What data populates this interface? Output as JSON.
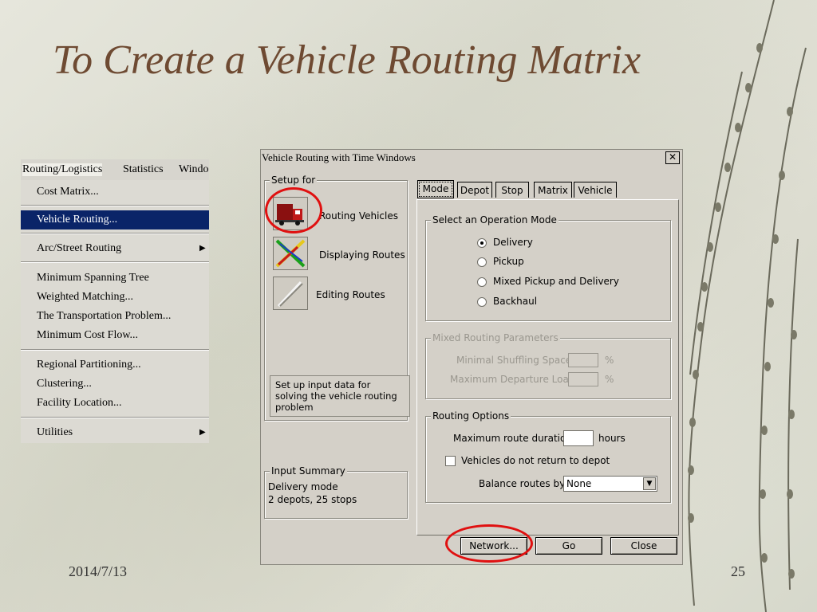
{
  "slide": {
    "title": "To Create a Vehicle Routing Matrix",
    "date": "2014/7/13",
    "page_number": "25"
  },
  "menu": {
    "bar": [
      "Routing/Logistics",
      "Statistics",
      "Windo"
    ],
    "items": [
      {
        "label": "Cost Matrix..."
      },
      {
        "label": "Vehicle Routing...",
        "selected": true
      },
      {
        "label": "Arc/Street Routing",
        "submenu": true
      },
      {
        "label": "Minimum Spanning Tree"
      },
      {
        "label": "Weighted Matching..."
      },
      {
        "label": "The Transportation Problem..."
      },
      {
        "label": "Minimum Cost Flow..."
      },
      {
        "label": "Regional Partitioning..."
      },
      {
        "label": "Clustering..."
      },
      {
        "label": "Facility Location..."
      },
      {
        "label": "Utilities",
        "submenu": true
      }
    ]
  },
  "dialog": {
    "title": "Vehicle Routing with Time Windows",
    "close_glyph": "✕",
    "setup_for": {
      "legend": "Setup for",
      "modes": [
        {
          "label": "Routing Vehicles",
          "icon": "truck-icon"
        },
        {
          "label": "Displaying Routes",
          "icon": "routes-icon"
        },
        {
          "label": "Editing Routes",
          "icon": "pen-icon"
        }
      ],
      "description": "Set up input data for solving the vehicle routing problem"
    },
    "input_summary": {
      "legend": "Input Summary",
      "line1": "Delivery mode",
      "line2": "2 depots, 25 stops"
    },
    "tabs": [
      "Mode",
      "Depot",
      "Stop",
      "Matrix",
      "Vehicle"
    ],
    "operation_mode": {
      "legend": "Select an Operation Mode",
      "options": [
        "Delivery",
        "Pickup",
        "Mixed Pickup and Delivery",
        "Backhaul"
      ],
      "selected": "Delivery"
    },
    "mixed_params": {
      "legend": "Mixed Routing Parameters",
      "shuffling_label": "Minimal Shuffling Space",
      "departure_label": "Maximum Departure Load",
      "unit": "%"
    },
    "routing_options": {
      "legend": "Routing Options",
      "duration_label": "Maximum route duration",
      "duration_unit": "hours",
      "no_return_label": "Vehicles do not return to depot",
      "balance_label": "Balance routes by",
      "balance_value": "None"
    },
    "buttons": {
      "network": "Network...",
      "go": "Go",
      "close": "Close"
    }
  },
  "colors": {
    "title": "#6e4a32",
    "menu_highlight": "#0a2468",
    "annotation_ring": "#e01010"
  }
}
